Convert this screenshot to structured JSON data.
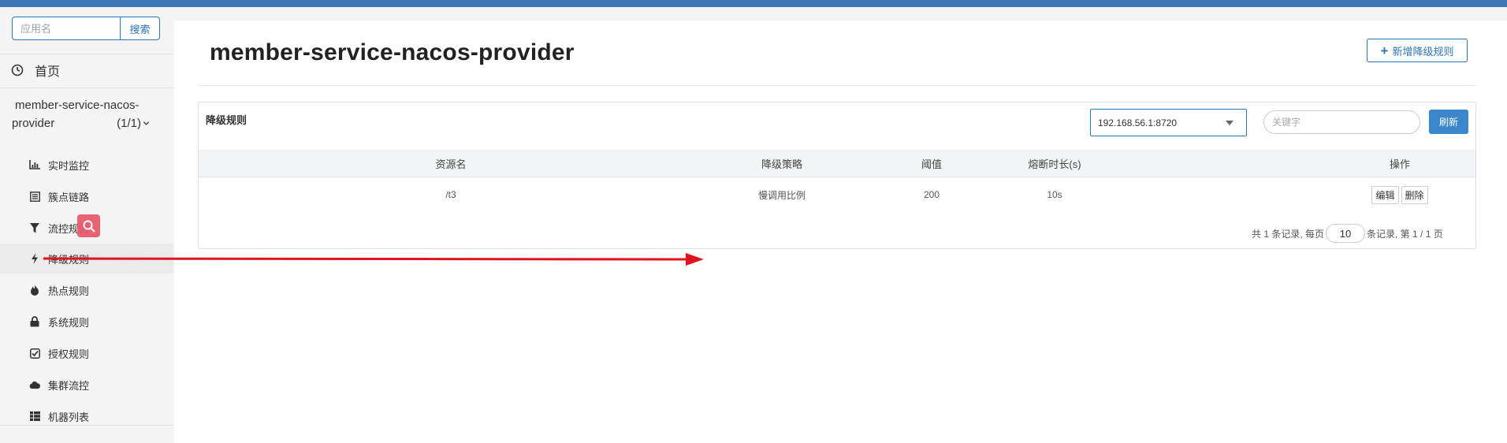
{
  "sidebar": {
    "search_placeholder": "应用名",
    "search_button": "搜索",
    "home_label": "首页",
    "app_name_line1": "member-service-nacos-",
    "app_name_line2": "provider",
    "app_count": "(1/1)",
    "items": [
      {
        "label": "实时监控",
        "icon": "bar-chart-icon"
      },
      {
        "label": "簇点链路",
        "icon": "list-icon"
      },
      {
        "label": "流控规则",
        "icon": "filter-icon"
      },
      {
        "label": "降级规则",
        "icon": "flash-icon",
        "active": true
      },
      {
        "label": "热点规则",
        "icon": "fire-icon"
      },
      {
        "label": "系统规则",
        "icon": "lock-icon"
      },
      {
        "label": "授权规则",
        "icon": "check-square-icon"
      },
      {
        "label": "集群流控",
        "icon": "cloud-icon"
      },
      {
        "label": "机器列表",
        "icon": "th-list-icon"
      }
    ]
  },
  "main": {
    "title": "member-service-nacos-provider",
    "add_button": "新增降级规则",
    "panel_title": "降级规则",
    "machine_select": "192.168.56.1:8720",
    "keyword_placeholder": "关键字",
    "refresh_button": "刷新",
    "table": {
      "headers": [
        "资源名",
        "降级策略",
        "阈值",
        "熔断时长(s)",
        "操作"
      ],
      "rows": [
        {
          "resource": "/t3",
          "strategy": "慢调用比例",
          "threshold": "200",
          "duration": "10s",
          "edit": "编辑",
          "delete": "删除"
        }
      ]
    },
    "pagination": {
      "prefix": "共 1 条记录, 每页",
      "page_size": "10",
      "suffix": "条记录, 第 1 / 1 页"
    }
  },
  "colors": {
    "accent": "#2f74b5",
    "topbar": "#3c78b5",
    "arrow": "#e0141e",
    "badge": "#e8576a"
  }
}
